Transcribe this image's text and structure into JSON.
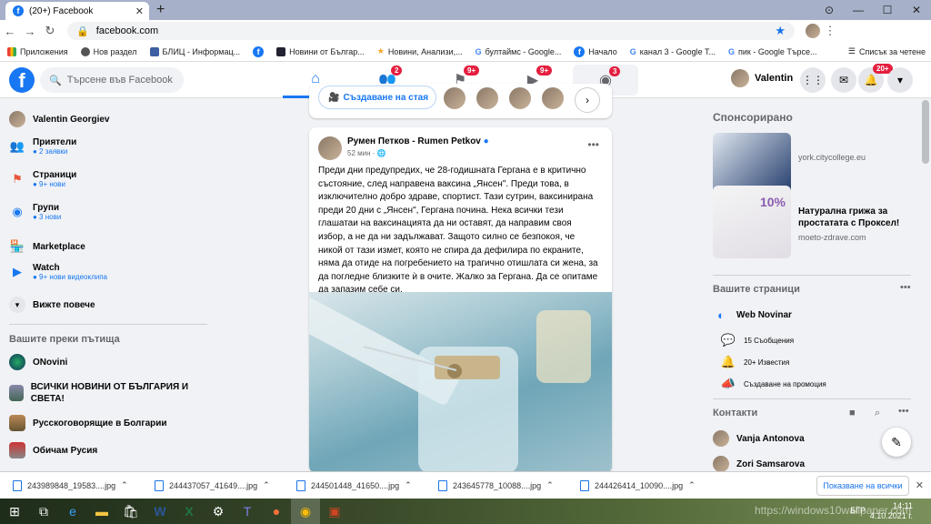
{
  "browser": {
    "tab_title": "(20+) Facebook",
    "url": "facebook.com",
    "bookmarks": [
      "Приложения",
      "Нов раздел",
      "БЛИЦ - Информац...",
      "",
      "Новини от Българ...",
      "Новини, Анализи,...",
      "бултаймс - Google...",
      "Начало",
      "канал 3 - Google T...",
      "пик - Google Търсе..."
    ],
    "reading_list": "Списък за четене"
  },
  "fb": {
    "search_placeholder": "Търсене във Facebook",
    "badges": {
      "friends": "2",
      "pages": "9+",
      "watch": "9+",
      "groups": "3",
      "notifications": "20+"
    },
    "profile_name": "Valentin"
  },
  "left": {
    "user": "Valentin Georgiev",
    "items": [
      {
        "label": "Приятели",
        "sub": "● 2 заявки"
      },
      {
        "label": "Страници",
        "sub": "● 9+ нови"
      },
      {
        "label": "Групи",
        "sub": "● 3 нови"
      },
      {
        "label": "Marketplace",
        "sub": ""
      },
      {
        "label": "Watch",
        "sub": "● 9+ нови видеоклипа"
      }
    ],
    "see_more": "Вижте повече",
    "shortcuts_title": "Вашите преки пътища",
    "shortcuts": [
      "ONovini",
      "ВСИЧКИ НОВИНИ ОТ БЪЛГАРИЯ И СВЕТА!",
      "Русскоговорящие в Болгарии",
      "Обичам Русия"
    ]
  },
  "story": {
    "create_room": "Създаване на стая"
  },
  "post": {
    "author": "Румен Петков - Rumen Petkov",
    "time": "52 мин · ",
    "text": "Преди дни предупредих, че 28-годишната Гергана е в критично състояние, след направена ваксина „Янсен\". Преди това, в изключително добро здраве, спортист. Тази сутрин, ваксинирана преди 20 дни с „Янсен\", Гергана почина. Нека всички тези глашатаи на ваксинацията да ни оставят, да направим своя избор, а не да ни задължават. Защото силно се безпокоя, че никой от тази измет, която не спира да дефилира по екраните, няма да отиде на погребението на трагично отишлата си жена, за да погледне близките ѝ в очите. Жалко за Гергана. Да се опитаме да запазим себе си."
  },
  "right": {
    "sponsored_title": "Спонсорирано",
    "ads": [
      {
        "title": "",
        "domain": "york.citycollege.eu"
      },
      {
        "title": "Натурална грижа за простатата с Проксел!",
        "domain": "moeto-zdrave.com",
        "badge": "10%"
      }
    ],
    "pages_title": "Вашите страници",
    "page_name": "Web Novinar",
    "page_items": [
      "15 Съобщения",
      "20+ Известия",
      "Създаване на промоция"
    ],
    "contacts_title": "Контакти",
    "contacts": [
      "Vanja Antonova",
      "Zori Samsarova"
    ]
  },
  "downloads": {
    "files": [
      "243989848_19583....jpg",
      "244437057_41649....jpg",
      "244501448_41650....jpg",
      "243645778_10088....jpg",
      "244426414_10090....jpg"
    ],
    "show_all": "Показване на всички"
  },
  "taskbar": {
    "time": "14:11",
    "date": "4.10.2021 г.",
    "lang": "БГР",
    "watermark": "https://windows10wallpaper.com"
  }
}
